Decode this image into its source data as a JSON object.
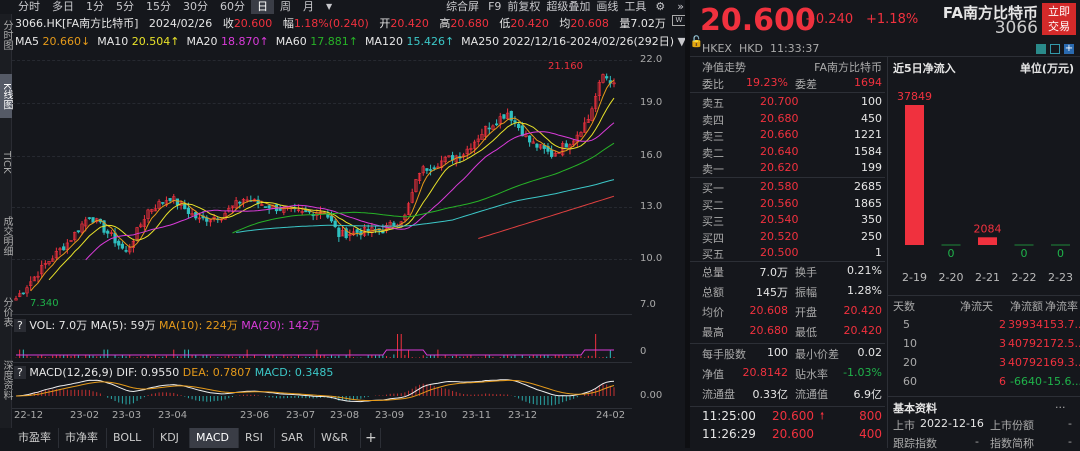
{
  "toolbar": {
    "periods": [
      "分时",
      "多日",
      "1分",
      "5分",
      "15分",
      "30分",
      "60分",
      "日",
      "周",
      "月"
    ],
    "selected": "日",
    "right": [
      "综合屏",
      "F9",
      "前复权",
      "超级叠加",
      "画线",
      "工具"
    ]
  },
  "sidebar": [
    "分时图",
    "K线图",
    "TICK",
    "成交明细",
    "分价表",
    "深度资料"
  ],
  "info": {
    "code": "3066.HK[FA南方比特币]",
    "date": "2024/02/26",
    "close_label": "收",
    "close": "20.600",
    "chg_label": "幅",
    "chg": "1.18%(0.240)",
    "open_label": "开",
    "open": "20.420",
    "high_label": "高",
    "high": "20.680",
    "low_label": "低",
    "low": "20.420",
    "avg_label": "均",
    "avg": "20.608",
    "vol_label": "量",
    "vol": "7.02万"
  },
  "ma": {
    "ma5": "MA5",
    "ma5v": "20.660↓",
    "ma10": "MA10",
    "ma10v": "20.504↑",
    "ma20": "MA20",
    "ma20v": "18.870↑",
    "ma60": "MA60",
    "ma60v": "17.881↑",
    "ma120": "MA120",
    "ma120v": "15.426↑",
    "ma250": "MA250",
    "range": "2022/12/16-2024/02/26(292日)"
  },
  "price_axis": [
    "22.0",
    "19.0",
    "16.0",
    "13.0",
    "10.0",
    "7.0"
  ],
  "price_marks": {
    "max": "21.160",
    "min": "7.340"
  },
  "vol": {
    "help": "?",
    "text": "VOL: 7.0万",
    "ma5": "MA(5): 59万",
    "ma10": "MA(10): 224万",
    "ma20": "MA(20): 142万",
    "axis": "0"
  },
  "macd": {
    "help": "?",
    "name": "MACD(12,26,9)",
    "dif": "DIF: 0.9550",
    "dea": "DEA: 0.7807",
    "macd": "MACD: 0.3485",
    "axis": "0.00"
  },
  "time_axis": [
    "22-12",
    "23-02",
    "23-03",
    "23-04",
    "23-06",
    "23-07",
    "23-08",
    "23-09",
    "23-10",
    "23-11",
    "23-12",
    "24-02"
  ],
  "tabs": [
    "市盈率",
    "市净率",
    "BOLL",
    "KDJ",
    "MACD",
    "RSI",
    "SAR",
    "W&R",
    "+"
  ],
  "chart_data": {
    "type": "candlestick",
    "xlabel": "",
    "ylabel": "",
    "ylim": [
      7,
      22
    ],
    "anchors": [
      [
        0,
        7.4
      ],
      [
        8,
        9.5
      ],
      [
        14,
        10.8
      ],
      [
        20,
        12.5
      ],
      [
        26,
        11.2
      ],
      [
        30,
        10.2
      ],
      [
        36,
        12.8
      ],
      [
        42,
        13.6
      ],
      [
        50,
        12.2
      ],
      [
        56,
        12.5
      ],
      [
        62,
        13.5
      ],
      [
        70,
        13.0
      ],
      [
        78,
        12.6
      ],
      [
        84,
        12.8
      ],
      [
        88,
        11.3
      ],
      [
        94,
        11.5
      ],
      [
        100,
        11.6
      ],
      [
        106,
        12.4
      ],
      [
        110,
        15.2
      ],
      [
        116,
        15.8
      ],
      [
        122,
        16.3
      ],
      [
        128,
        17.8
      ],
      [
        134,
        18.8
      ],
      [
        140,
        17.0
      ],
      [
        146,
        16.2
      ],
      [
        152,
        17.2
      ],
      [
        156,
        18.4
      ],
      [
        160,
        21.1
      ],
      [
        163,
        20.6
      ]
    ]
  },
  "quote": {
    "price": "20.600",
    "change": "+0.240",
    "pct": "+1.18%",
    "name": "FA南方比特币",
    "code": "3066",
    "trade_btn": "立即交易",
    "exchange": "HKEX",
    "currency": "HKD",
    "time": "11:33:37"
  },
  "book": {
    "title": "净值走势",
    "title_r": "FA南方比特币",
    "wb_label": "委比",
    "wb": "19.23%",
    "wc_label": "委差",
    "wc": "1694",
    "asks": [
      {
        "l": "卖五",
        "p": "20.700",
        "v": "100"
      },
      {
        "l": "卖四",
        "p": "20.680",
        "v": "450"
      },
      {
        "l": "卖三",
        "p": "20.660",
        "v": "1221"
      },
      {
        "l": "卖二",
        "p": "20.640",
        "v": "1584"
      },
      {
        "l": "卖一",
        "p": "20.620",
        "v": "199"
      }
    ],
    "bids": [
      {
        "l": "买一",
        "p": "20.580",
        "v": "2685"
      },
      {
        "l": "买二",
        "p": "20.560",
        "v": "1865"
      },
      {
        "l": "买三",
        "p": "20.540",
        "v": "350"
      },
      {
        "l": "买四",
        "p": "20.520",
        "v": "250"
      },
      {
        "l": "买五",
        "p": "20.500",
        "v": "1"
      }
    ]
  },
  "stats": [
    {
      "l1": "总量",
      "v1": "7.0万",
      "l2": "换手",
      "v2": "0.21%",
      "c1": "w",
      "c2": "w"
    },
    {
      "l1": "总额",
      "v1": "145万",
      "l2": "振幅",
      "v2": "1.28%",
      "c1": "w",
      "c2": "w"
    },
    {
      "l1": "均价",
      "v1": "20.608",
      "l2": "开盘",
      "v2": "20.420",
      "c1": "r",
      "c2": "r"
    },
    {
      "l1": "最高",
      "v1": "20.680",
      "l2": "最低",
      "v2": "20.420",
      "c1": "r",
      "c2": "r"
    },
    {
      "l1": "每手股数",
      "v1": "100",
      "l2": "最小价差",
      "v2": "0.02",
      "c1": "w",
      "c2": "w"
    },
    {
      "l1": "净值",
      "v1": "20.8142",
      "l2": "贴水率",
      "v2": "-1.03%",
      "c1": "r",
      "c2": "g"
    },
    {
      "l1": "流通盘",
      "v1": "0.33亿",
      "l2": "流通值",
      "v2": "6.9亿",
      "c1": "w",
      "c2": "w"
    }
  ],
  "trades": [
    {
      "t": "11:25:00",
      "p": "20.600",
      "arrow": "🠕",
      "v": "800"
    },
    {
      "t": "11:26:29",
      "p": "20.600",
      "arrow": "",
      "v": "400"
    }
  ],
  "flow": {
    "title": "近5日净流入",
    "unit": "单位(万元)",
    "bars": [
      {
        "d": "2-19",
        "v": 37849,
        "label": "37849"
      },
      {
        "d": "2-20",
        "v": 0,
        "label": "0"
      },
      {
        "d": "2-21",
        "v": 2084,
        "label": "2084"
      },
      {
        "d": "2-22",
        "v": 0,
        "label": "0"
      },
      {
        "d": "2-23",
        "v": 0,
        "label": "0"
      }
    ],
    "headers": [
      "天数",
      "净流天",
      "净流额",
      "净流率"
    ],
    "rows": [
      [
        "5",
        "2",
        "39934",
        "153.7..."
      ],
      [
        "10",
        "3",
        "40792",
        "172.5..."
      ],
      [
        "20",
        "3",
        "40792",
        "169.3..."
      ],
      [
        "60",
        "6",
        "-6640",
        "-15.6..."
      ]
    ]
  },
  "basic": {
    "title": "基本资料",
    "more": "...",
    "list_label": "上市",
    "list_date": "2022-12-16",
    "share_label": "上市份额",
    "share": "-",
    "track_label": "跟踪指数",
    "track": "-",
    "idx_label": "指数简称",
    "idx": "-"
  },
  "colors": {
    "up": "#f0313e",
    "down": "#2fc0c0",
    "bg": "#15171c"
  }
}
